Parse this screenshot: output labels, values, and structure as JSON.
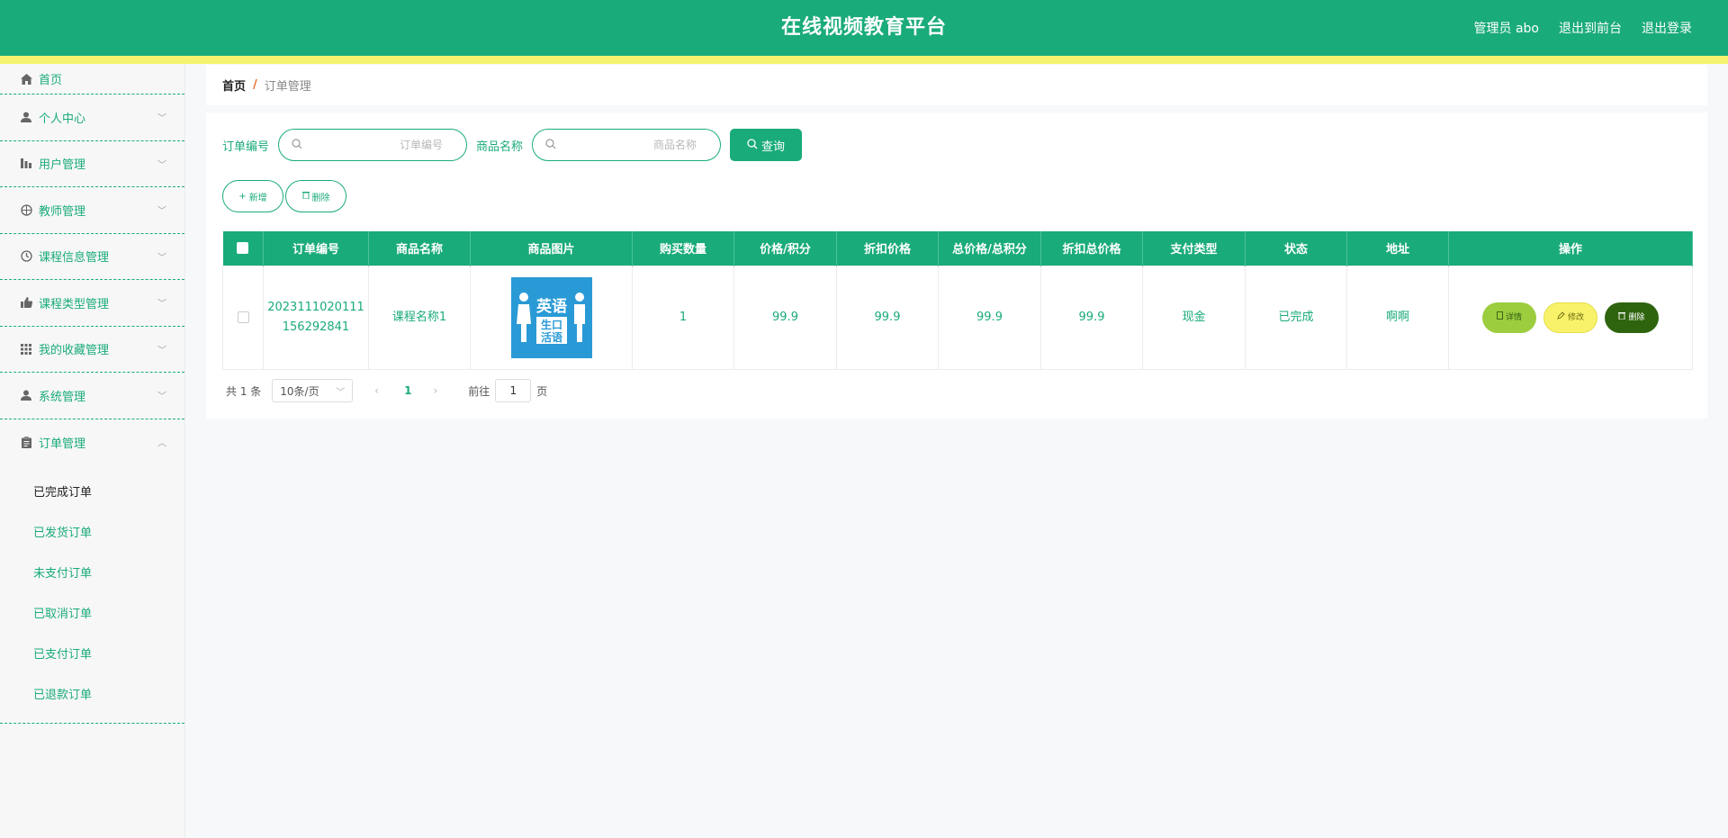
{
  "header": {
    "title": "在线视频教育平台",
    "admin": "管理员 abo",
    "back_front": "退出到前台",
    "logout": "退出登录"
  },
  "sidebar": {
    "items": [
      {
        "label": "首页",
        "icon": "home-icon"
      },
      {
        "label": "个人中心",
        "icon": "user-icon"
      },
      {
        "label": "用户管理",
        "icon": "chart-icon"
      },
      {
        "label": "教师管理",
        "icon": "compass-icon"
      },
      {
        "label": "课程信息管理",
        "icon": "clock-icon"
      },
      {
        "label": "课程类型管理",
        "icon": "thumb-icon"
      },
      {
        "label": "我的收藏管理",
        "icon": "grid-icon"
      },
      {
        "label": "系统管理",
        "icon": "user-icon"
      },
      {
        "label": "订单管理",
        "icon": "clipboard-icon"
      }
    ],
    "sub_items": [
      {
        "label": "已完成订单",
        "active": true
      },
      {
        "label": "已发货订单"
      },
      {
        "label": "未支付订单"
      },
      {
        "label": "已取消订单"
      },
      {
        "label": "已支付订单"
      },
      {
        "label": "已退款订单"
      }
    ]
  },
  "breadcrumb": {
    "home": "首页",
    "sep": "/",
    "current": "订单管理"
  },
  "search": {
    "order_label": "订单编号",
    "order_placeholder": "订单编号",
    "product_label": "商品名称",
    "product_placeholder": "商品名称",
    "query_label": "查询"
  },
  "actions": {
    "add_label": "新增",
    "delete_label": "删除"
  },
  "table": {
    "columns": [
      "订单编号",
      "商品名称",
      "商品图片",
      "购买数量",
      "价格/积分",
      "折扣价格",
      "总价格/总积分",
      "折扣总价格",
      "支付类型",
      "状态",
      "地址",
      "操作"
    ],
    "rows": [
      {
        "order_no_line1": "2023111020111",
        "order_no_line2": "156292841",
        "product_name": "课程名称1",
        "image_text_top": "英语",
        "image_text_bottom": "生口\n活语",
        "quantity": "1",
        "price": "99.9",
        "discount_price": "99.9",
        "total_price": "99.9",
        "discount_total": "99.9",
        "pay_type": "现金",
        "status": "已完成",
        "address": "啊啊",
        "detail_label": "详情",
        "edit_label": "修改",
        "delete_label": "删除"
      }
    ]
  },
  "pagination": {
    "total_text": "共 1 条",
    "page_size": "10条/页",
    "current_page": "1",
    "goto_label": "前往",
    "goto_value": "1",
    "page_suffix": "页"
  },
  "colors": {
    "primary": "#1aab7a",
    "stripe": "#f6f36f",
    "detail_btn": "#9ccd3f",
    "edit_btn": "#f7f26a",
    "delete_btn": "#2f640e"
  }
}
